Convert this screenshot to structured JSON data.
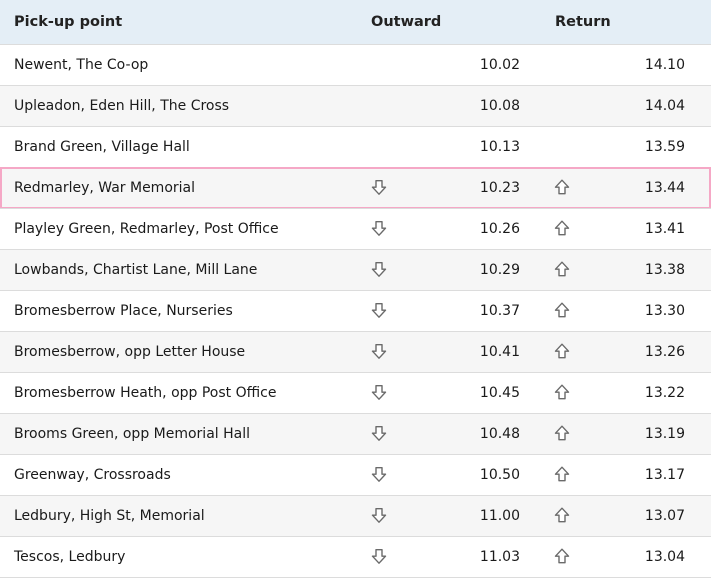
{
  "header": {
    "pickup": "Pick-up point",
    "outward": "Outward",
    "return": "Return"
  },
  "rows": [
    {
      "name": "Newent, The Co-op",
      "outward": "10.02",
      "return": "14.10",
      "arrows": false
    },
    {
      "name": "Upleadon, Eden Hill, The Cross",
      "outward": "10.08",
      "return": "14.04",
      "arrows": false
    },
    {
      "name": "Brand Green, Village Hall",
      "outward": "10.13",
      "return": "13.59",
      "arrows": false
    },
    {
      "name": "Redmarley, War Memorial",
      "outward": "10.23",
      "return": "13.44",
      "arrows": true,
      "highlighted": true
    },
    {
      "name": "Playley Green, Redmarley, Post Office",
      "outward": "10.26",
      "return": "13.41",
      "arrows": true
    },
    {
      "name": "Lowbands, Chartist Lane, Mill Lane",
      "outward": "10.29",
      "return": "13.38",
      "arrows": true
    },
    {
      "name": "Bromesberrow Place, Nurseries",
      "outward": "10.37",
      "return": "13.30",
      "arrows": true
    },
    {
      "name": "Bromesberrow, opp Letter House",
      "outward": "10.41",
      "return": "13.26",
      "arrows": true
    },
    {
      "name": "Bromesberrow Heath, opp Post Office",
      "outward": "10.45",
      "return": "13.22",
      "arrows": true
    },
    {
      "name": "Brooms Green, opp Memorial Hall",
      "outward": "10.48",
      "return": "13.19",
      "arrows": true
    },
    {
      "name": "Greenway, Crossroads",
      "outward": "10.50",
      "return": "13.17",
      "arrows": true
    },
    {
      "name": "Ledbury, High St, Memorial",
      "outward": "11.00",
      "return": "13.07",
      "arrows": true
    },
    {
      "name": "Tescos, Ledbury",
      "outward": "11.03",
      "return": "13.04",
      "arrows": true
    }
  ],
  "icons": {
    "outward": "arrow-down-icon",
    "return": "arrow-up-icon"
  },
  "colors": {
    "header_bg": "#e4eef6",
    "highlight_border": "#f5a8c6",
    "alt_row_bg": "#f6f6f6"
  }
}
